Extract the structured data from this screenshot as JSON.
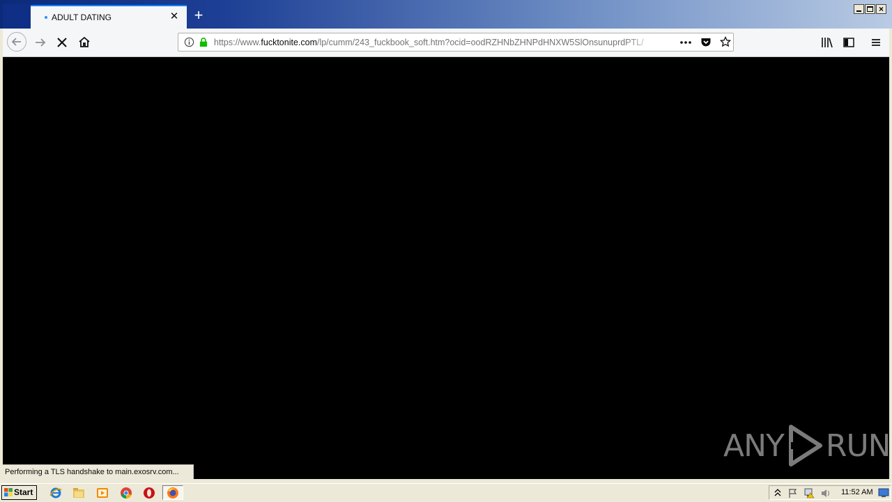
{
  "browser": {
    "tab": {
      "title": "ADULT DATING",
      "close_icon": "close-icon"
    },
    "url": {
      "scheme": "https://www.",
      "host": "fucktonite.com",
      "path": "/lp/cumm/243_fuckbook_soft.htm?ocid=oodRZHNbZHNPdHNXW5SlOnsunuprdPTL/"
    },
    "status_text": "Performing a TLS handshake to main.exosrv.com...",
    "page_action_icon": "more-icon",
    "icons": [
      "back-arrow-icon",
      "forward-arrow-icon",
      "stop-icon",
      "home-icon",
      "info-icon",
      "lock-icon",
      "pocket-icon",
      "star-icon",
      "library-icon",
      "sidebar-icon",
      "menu-icon"
    ]
  },
  "watermark": {
    "left": "ANY",
    "right": "RUN"
  },
  "taskbar": {
    "start_label": "Start",
    "clock": "11:52 AM"
  },
  "colors": {
    "accent": "#0a84ff",
    "lock": "#12bc00",
    "page_bg": "#000000"
  }
}
